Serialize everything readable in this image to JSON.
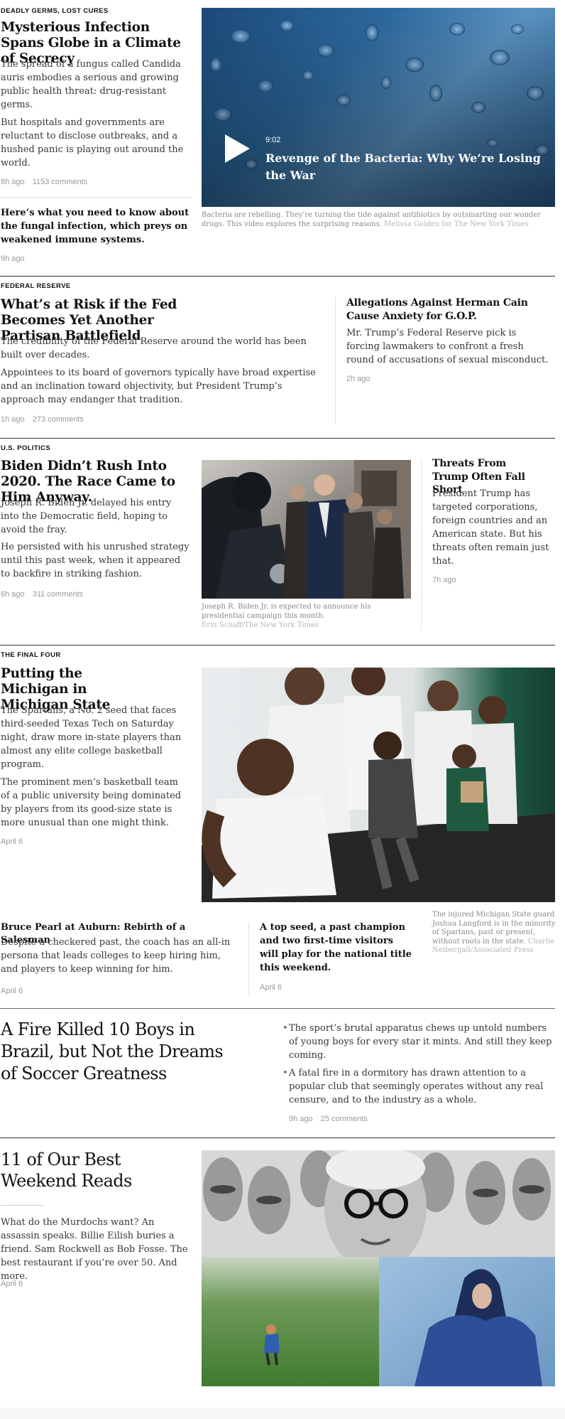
{
  "story1": {
    "kicker": "Deadly Germs, Lost Cures",
    "headline": "Mysterious Infection Spans Globe in a Climate of Secrecy",
    "summary1": "The spread of a fungus called Candida auris embodies a serious and growing public health threat: drug-resistant germs.",
    "summary2": "But hospitals and governments are reluctant to disclose outbreaks, and a hushed panic is playing out around the world.",
    "time": "8h ago",
    "comments": "1153 comments",
    "related_headline": "Here’s what you need to know about the fungal infection, which preys on weakened immune systems.",
    "related_time": "9h ago",
    "video": {
      "duration": "9:02",
      "title": "Revenge of the Bacteria: Why We’re Losing the War",
      "caption": "Bacteria are rebelling. They’re turning the tide against antibiotics by outsmarting our wonder drugs. This video explores the surprising reasons.",
      "credit": "Melissa Golden for The New York Times"
    }
  },
  "story2": {
    "kicker": "Federal Reserve",
    "headline": "What’s at Risk if the Fed Becomes Yet Another Partisan Battlefield",
    "summary1": "The credibility of the Federal Reserve around the world has been built over decades.",
    "summary2": "Appointees to its board of governors typically have broad expertise and an inclination toward objectivity, but President Trump’s approach may endanger that tradition.",
    "time": "1h ago",
    "comments": "273 comments",
    "side_headline": "Allegations Against Herman Cain Cause Anxiety for G.O.P.",
    "side_summary": "Mr. Trump’s Federal Reserve pick is forcing lawmakers to confront a fresh round of accusations of sexual misconduct.",
    "side_time": "2h ago"
  },
  "story3": {
    "kicker": "U.S. Politics",
    "headline": "Biden Didn’t Rush Into 2020. The Race Came to Him Anyway.",
    "summary1": "Joseph R. Biden Jr. delayed his entry into the Democratic field, hoping to avoid the fray.",
    "summary2": "He persisted with his unrushed strategy until this past week, when it appeared to backfire in striking fashion.",
    "time": "6h ago",
    "comments": "311 comments",
    "caption": "Joseph R. Biden Jr. is expected to announce his presidential campaign this month.",
    "credit": "Erin Schaff/The New York Times",
    "side_headline": "Threats From Trump Often Fall Short",
    "side_summary": "President Trump has targeted corporations, foreign countries and an American state. But his threats often remain just that.",
    "side_time": "7h ago"
  },
  "story4": {
    "kicker": "The Final Four",
    "headline": "Putting the Michigan in Michigan State",
    "summary1": "The Spartans, a No. 2 seed that faces third-seeded Texas Tech on Saturday night, draw more in-state players than almost any elite college basketball program.",
    "summary2": "The prominent men’s basketball team of a public university being dominated by players from its good-size state is more unusual than one might think.",
    "time": "April 6",
    "caption": "The injured Michigan State guard Joshua Langford is in the minority of Spartans, past or present, without roots in the state.",
    "credit": "Charlie Neibergall/Associated Press",
    "sub1_headline": "Bruce Pearl at Auburn: Rebirth of a Salesman",
    "sub1_summary": "Despite a checkered past, the coach has an all-in persona that leads colleges to keep hiring him, and players to keep winning for him.",
    "sub1_time": "April 6",
    "sub2_headline": "A top seed, a past champion and two first-time visitors will play for the national title this weekend.",
    "sub2_time": "April 6"
  },
  "story5": {
    "headline": "A Fire Killed 10 Boys in Brazil, but Not the Dreams of Soccer Greatness",
    "bullet1": "The sport’s brutal apparatus chews up untold numbers of young boys for every star it mints. And still they keep coming.",
    "bullet2": "A fatal fire in a dormitory has drawn attention to a popular club that seemingly operates without any real censure, and to the industry as a whole.",
    "time": "9h ago",
    "comments": "25 comments"
  },
  "story6": {
    "headline": "11 of Our Best Weekend Reads",
    "summary": "What do the Murdochs want? An assassin speaks. Billie Eilish buries a friend. Sam Rockwell as Bob Fosse. The best restaurant if you’re over 50. And more.",
    "time": "April 6"
  }
}
